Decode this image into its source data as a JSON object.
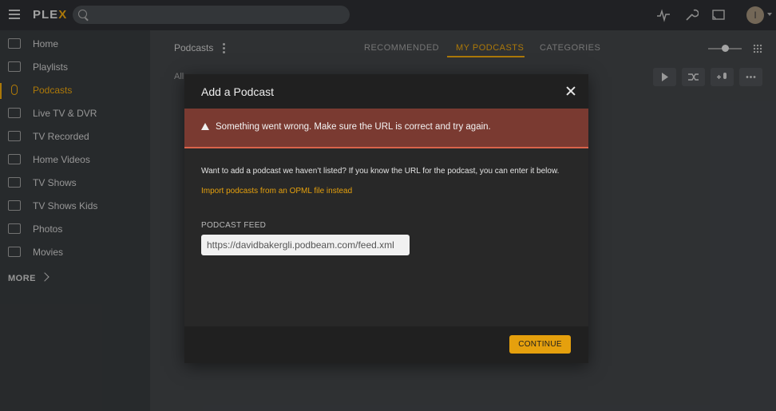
{
  "app": {
    "logo_main": "PLE",
    "logo_accent": "X",
    "user_initial": "I"
  },
  "search": {
    "placeholder": ""
  },
  "sidebar": {
    "items": [
      {
        "label": "Home",
        "icon": "home-icon"
      },
      {
        "label": "Playlists",
        "icon": "list-icon"
      },
      {
        "label": "Podcasts",
        "icon": "microphone-icon",
        "active": true
      },
      {
        "label": "Live TV & DVR",
        "icon": "tv-icon"
      },
      {
        "label": "TV Recorded",
        "icon": "monitor-icon"
      },
      {
        "label": "Home Videos",
        "icon": "video-camera-icon"
      },
      {
        "label": "TV Shows",
        "icon": "monitor-icon"
      },
      {
        "label": "TV Shows Kids",
        "icon": "film-icon"
      },
      {
        "label": "Photos",
        "icon": "camera-icon"
      },
      {
        "label": "Movies",
        "icon": "film-icon"
      }
    ],
    "more_label": "MORE"
  },
  "header": {
    "title": "Podcasts",
    "tabs": [
      {
        "label": "RECOMMENDED"
      },
      {
        "label": "MY PODCASTS",
        "active": true
      },
      {
        "label": "CATEGORIES"
      }
    ],
    "filter_text": "All"
  },
  "modal": {
    "title": "Add a Podcast",
    "error": "Something went wrong. Make sure the URL is correct and try again.",
    "description": "Want to add a podcast we haven’t listed? If you know the URL for the podcast, you can enter it below.",
    "opml_link": "Import podcasts from an OPML file instead",
    "feed_label": "PODCAST FEED",
    "feed_value": "https://davidbakergli.podbeam.com/feed.xml",
    "continue_label": "CONTINUE"
  },
  "colors": {
    "accent": "#e5a00d",
    "error_bg": "#7a3a31"
  }
}
